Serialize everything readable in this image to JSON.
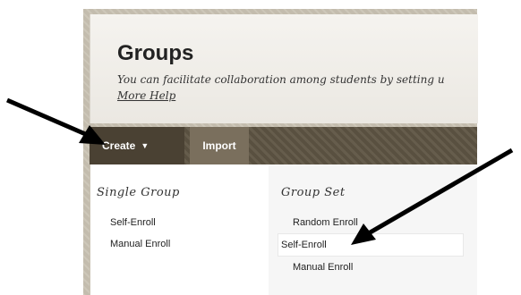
{
  "header": {
    "title": "Groups",
    "description": "You can facilitate collaboration among students by setting u",
    "help_link": "More Help"
  },
  "toolbar": {
    "create_label": "Create",
    "create_chevron": "⌄",
    "import_label": "Import"
  },
  "dropdown": {
    "single_group": {
      "heading": "Single Group",
      "items": [
        "Self-Enroll",
        "Manual Enroll"
      ]
    },
    "group_set": {
      "heading": "Group Set",
      "items": [
        "Random Enroll",
        "Self-Enroll",
        "Manual Enroll"
      ]
    }
  },
  "annotations": {
    "arrow_color": "#000000"
  }
}
